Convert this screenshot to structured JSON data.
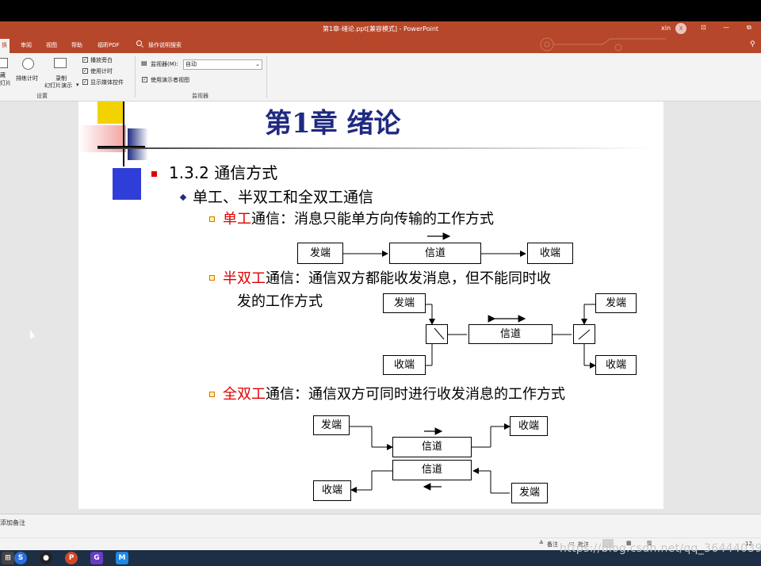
{
  "app": {
    "title": "第1章-绪论.ppt[兼容模式] - PowerPoint",
    "user": "xin",
    "user_initial": "X"
  },
  "tabs": [
    {
      "label": "换",
      "active": true
    },
    {
      "label": "审阅"
    },
    {
      "label": "视图"
    },
    {
      "label": "帮助"
    },
    {
      "label": "福昕PDF"
    },
    {
      "label": "操作说明搜索"
    }
  ],
  "ribbon": {
    "left_btn_line1": "藏",
    "left_btn_line2": "灯片",
    "rehearse": "排练计时",
    "record_line1": "录制",
    "record_line2": "幻灯片演示",
    "chk_narration": "播放旁白",
    "chk_timing": "使用计时",
    "chk_media": "显示媒体控件",
    "group_setup": "设置",
    "monitor_label": "监视器(M):",
    "monitor_value": "自动",
    "chk_presenter": "使用演示者视图",
    "group_monitor": "监视器"
  },
  "slide": {
    "title": "第1章 绪论",
    "section": "1.3.2 通信方式",
    "sub": "单工、半双工和全双工通信",
    "simplex_red": "单工",
    "simplex_text": "通信：消息只能单方向传输的工作方式",
    "half_red": "半双工",
    "half_text": "通信：通信双方都能收发消息，但不能同时收",
    "half_text2": "发的工作方式",
    "full_red": "全双工",
    "full_text": "通信：通信双方可同时进行收发消息的工作方式",
    "send": "发端",
    "recv": "收端",
    "channel": "信道"
  },
  "notes": {
    "placeholder": "添加备注"
  },
  "status": {
    "notes_btn": "备注",
    "comments_btn": "批注",
    "zoom": "12"
  },
  "watermark": "https://blog.csdn.net/qq_36444039",
  "colors": {
    "accent": "#b7472a",
    "slide_title": "#1f2a80",
    "emphasis": "#e00000"
  }
}
